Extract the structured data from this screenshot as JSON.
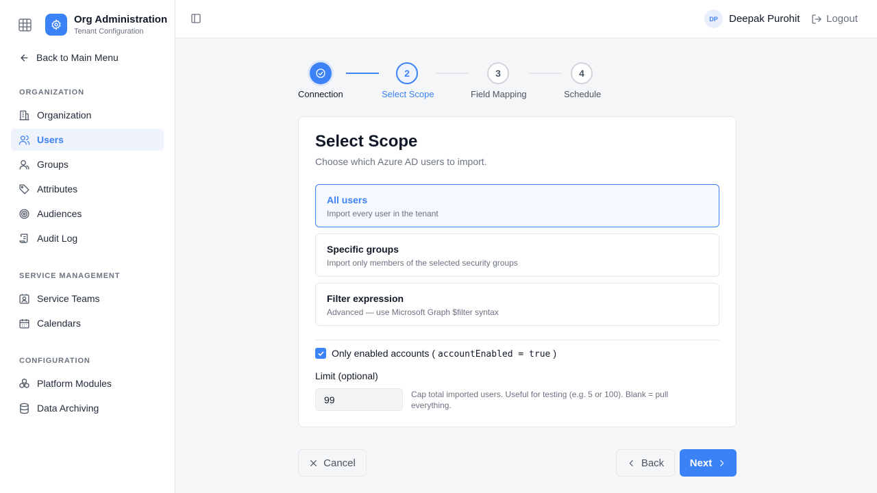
{
  "brand": {
    "title": "Org Administration",
    "subtitle": "Tenant Configuration"
  },
  "nav": {
    "back_label": "Back to Main Menu",
    "sections": [
      {
        "title": "ORGANIZATION",
        "items": [
          {
            "label": "Organization",
            "icon": "building-icon"
          },
          {
            "label": "Users",
            "icon": "users-icon",
            "active": true
          },
          {
            "label": "Groups",
            "icon": "user-group-icon"
          },
          {
            "label": "Attributes",
            "icon": "tag-icon"
          },
          {
            "label": "Audiences",
            "icon": "target-icon"
          },
          {
            "label": "Audit Log",
            "icon": "scroll-icon"
          }
        ]
      },
      {
        "title": "SERVICE MANAGEMENT",
        "items": [
          {
            "label": "Service Teams",
            "icon": "contact-icon"
          },
          {
            "label": "Calendars",
            "icon": "calendar-icon"
          }
        ]
      },
      {
        "title": "CONFIGURATION",
        "items": [
          {
            "label": "Platform Modules",
            "icon": "boxes-icon"
          },
          {
            "label": "Data Archiving",
            "icon": "database-icon"
          }
        ]
      }
    ]
  },
  "header": {
    "avatar_initials": "DP",
    "user_name": "Deepak Purohit",
    "logout_label": "Logout"
  },
  "stepper": {
    "steps": [
      {
        "number": "1",
        "label": "Connection",
        "state": "done"
      },
      {
        "number": "2",
        "label": "Select Scope",
        "state": "current"
      },
      {
        "number": "3",
        "label": "Field Mapping",
        "state": "todo"
      },
      {
        "number": "4",
        "label": "Schedule",
        "state": "todo"
      }
    ]
  },
  "card": {
    "title": "Select Scope",
    "subtitle": "Choose which Azure AD users to import.",
    "options": [
      {
        "title": "All users",
        "description": "Import every user in the tenant",
        "selected": true
      },
      {
        "title": "Specific groups",
        "description": "Import only members of the selected security groups",
        "selected": false
      },
      {
        "title": "Filter expression",
        "description": "Advanced — use Microsoft Graph $filter syntax",
        "selected": false
      }
    ],
    "enabled_only": {
      "checked": true,
      "label": "Only enabled accounts (",
      "code": "accountEnabled = true",
      "suffix": ")"
    },
    "limit": {
      "label": "Limit (optional)",
      "value": "99",
      "help": "Cap total imported users. Useful for testing (e.g. 5 or 100). Blank = pull everything."
    }
  },
  "footer": {
    "cancel_label": "Cancel",
    "back_label": "Back",
    "next_label": "Next"
  },
  "colors": {
    "accent": "#3b82f6",
    "sidebar_active_bg": "#eef2fb",
    "page_bg": "#f5f6f8"
  }
}
